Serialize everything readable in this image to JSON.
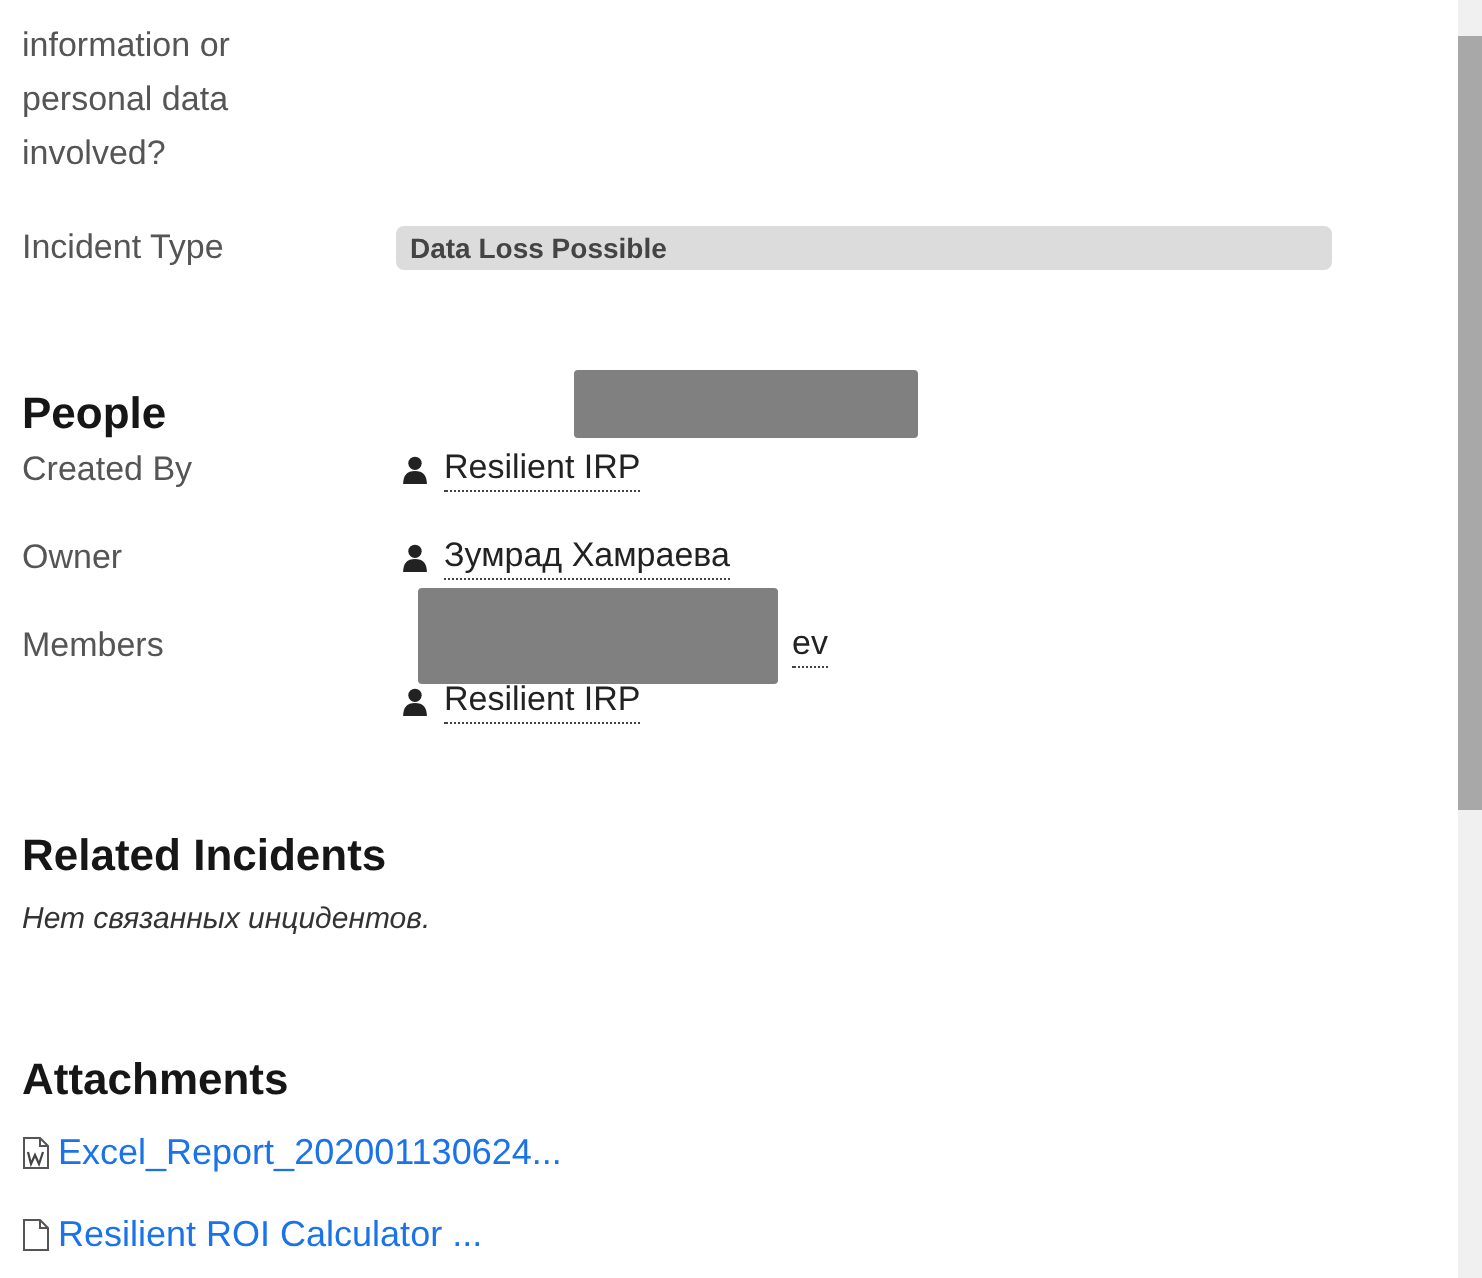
{
  "question_label": "information or personal data involved?",
  "incident_type": {
    "label": "Incident Type",
    "value": "Data Loss Possible"
  },
  "people": {
    "heading": "People",
    "rows": [
      {
        "label": "Created By",
        "users": [
          {
            "name": "Resilient IRP",
            "redacted": false
          }
        ]
      },
      {
        "label": "Owner",
        "users": [
          {
            "name": "Зумрад Хамраева",
            "redacted": false
          }
        ]
      },
      {
        "label": "Members",
        "users": [
          {
            "name": "ev",
            "redacted": true
          },
          {
            "name": "Resilient IRP",
            "redacted": false
          }
        ]
      }
    ]
  },
  "related": {
    "heading": "Related Incidents",
    "empty_text": "Нет связанных инцидентов."
  },
  "attachments": {
    "heading": "Attachments",
    "items": [
      {
        "name": "Excel_Report_202001130624...",
        "kind": "word"
      },
      {
        "name": "Resilient ROI Calculator ...",
        "kind": "file"
      }
    ]
  }
}
